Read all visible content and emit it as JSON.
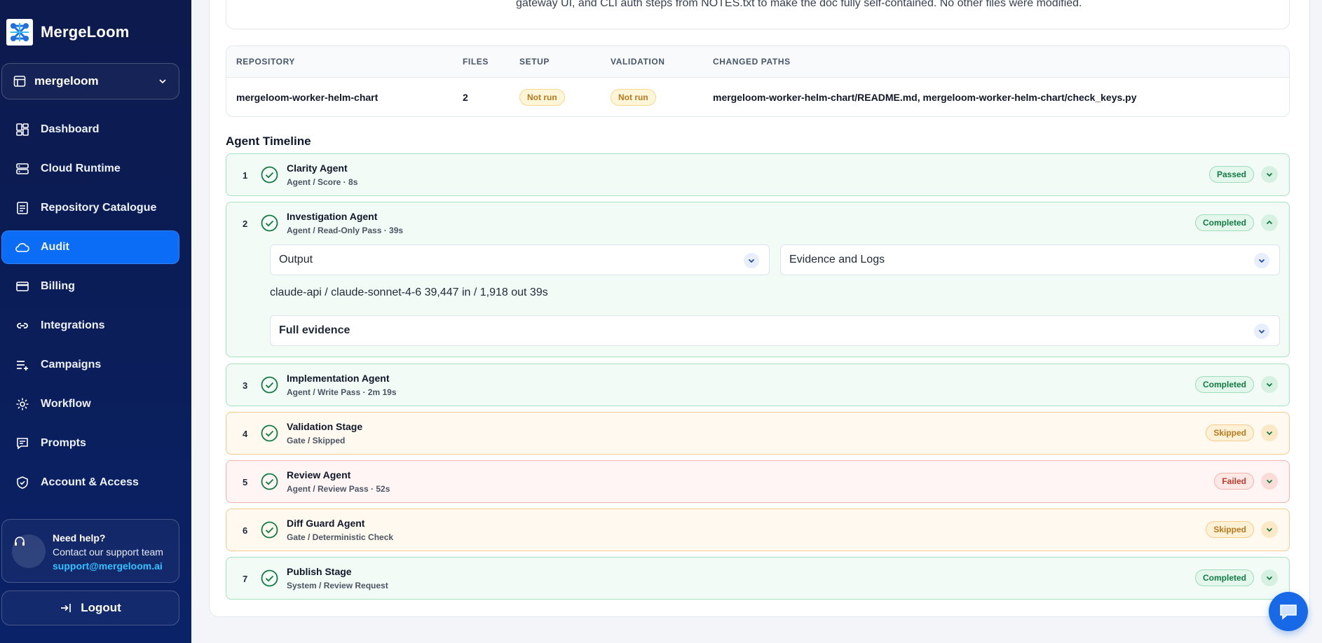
{
  "brand": {
    "name": "MergeLoom"
  },
  "workspace": {
    "name": "mergeloom"
  },
  "nav": [
    {
      "label": "Dashboard",
      "icon": "dashboard-icon"
    },
    {
      "label": "Cloud Runtime",
      "icon": "server-icon"
    },
    {
      "label": "Repository Catalogue",
      "icon": "catalogue-icon"
    },
    {
      "label": "Audit",
      "icon": "cloud-icon",
      "active": true
    },
    {
      "label": "Billing",
      "icon": "credit-card-icon"
    },
    {
      "label": "Integrations",
      "icon": "link-icon"
    },
    {
      "label": "Campaigns",
      "icon": "list-plus-icon"
    },
    {
      "label": "Workflow",
      "icon": "gear-icon"
    },
    {
      "label": "Prompts",
      "icon": "chat-icon"
    },
    {
      "label": "Account & Access",
      "icon": "shield-icon"
    }
  ],
  "help": {
    "title": "Need help?",
    "subtitle": "Contact our support team",
    "email": "support@mergeloom.ai"
  },
  "logout": {
    "label": "Logout"
  },
  "note": {
    "text": "gateway UI, and CLI auth steps from NOTES.txt to make the doc fully self-contained. No other files were modified."
  },
  "repo_table": {
    "headers": {
      "repository": "REPOSITORY",
      "files": "FILES",
      "setup": "SETUP",
      "validation": "VALIDATION",
      "changed_paths": "CHANGED PATHS"
    },
    "row": {
      "repository": "mergeloom-worker-helm-chart",
      "files": "2",
      "setup": "Not run",
      "validation": "Not run",
      "changed_paths": "mergeloom-worker-helm-chart/README.md, mergeloom-worker-helm-chart/check_keys.py"
    }
  },
  "timeline": {
    "title": "Agent Timeline",
    "stages": [
      {
        "num": "1",
        "title": "Clarity Agent",
        "sub": "Agent / Score · 8s",
        "status": "Passed"
      },
      {
        "num": "2",
        "title": "Investigation Agent",
        "sub": "Agent / Read-Only Pass · 39s",
        "status": "Completed",
        "expanded": {
          "output_label": "Output",
          "evidence_label": "Evidence and Logs",
          "meta": "claude-api / claude-sonnet-4-6 39,447 in / 1,918 out 39s",
          "full_evidence_label": "Full evidence"
        }
      },
      {
        "num": "3",
        "title": "Implementation Agent",
        "sub": "Agent / Write Pass · 2m 19s",
        "status": "Completed"
      },
      {
        "num": "4",
        "title": "Validation Stage",
        "sub": "Gate / Skipped",
        "status": "Skipped"
      },
      {
        "num": "5",
        "title": "Review Agent",
        "sub": "Agent / Review Pass · 52s",
        "status": "Failed"
      },
      {
        "num": "6",
        "title": "Diff Guard Agent",
        "sub": "Gate / Deterministic Check",
        "status": "Skipped"
      },
      {
        "num": "7",
        "title": "Publish Stage",
        "sub": "System / Review Request",
        "status": "Completed"
      }
    ]
  },
  "colors": {
    "accent": "#0b6cf5",
    "sidebar": "#0c1a4d",
    "success": "#117a44",
    "warning": "#b7791f",
    "danger": "#c0392b"
  }
}
